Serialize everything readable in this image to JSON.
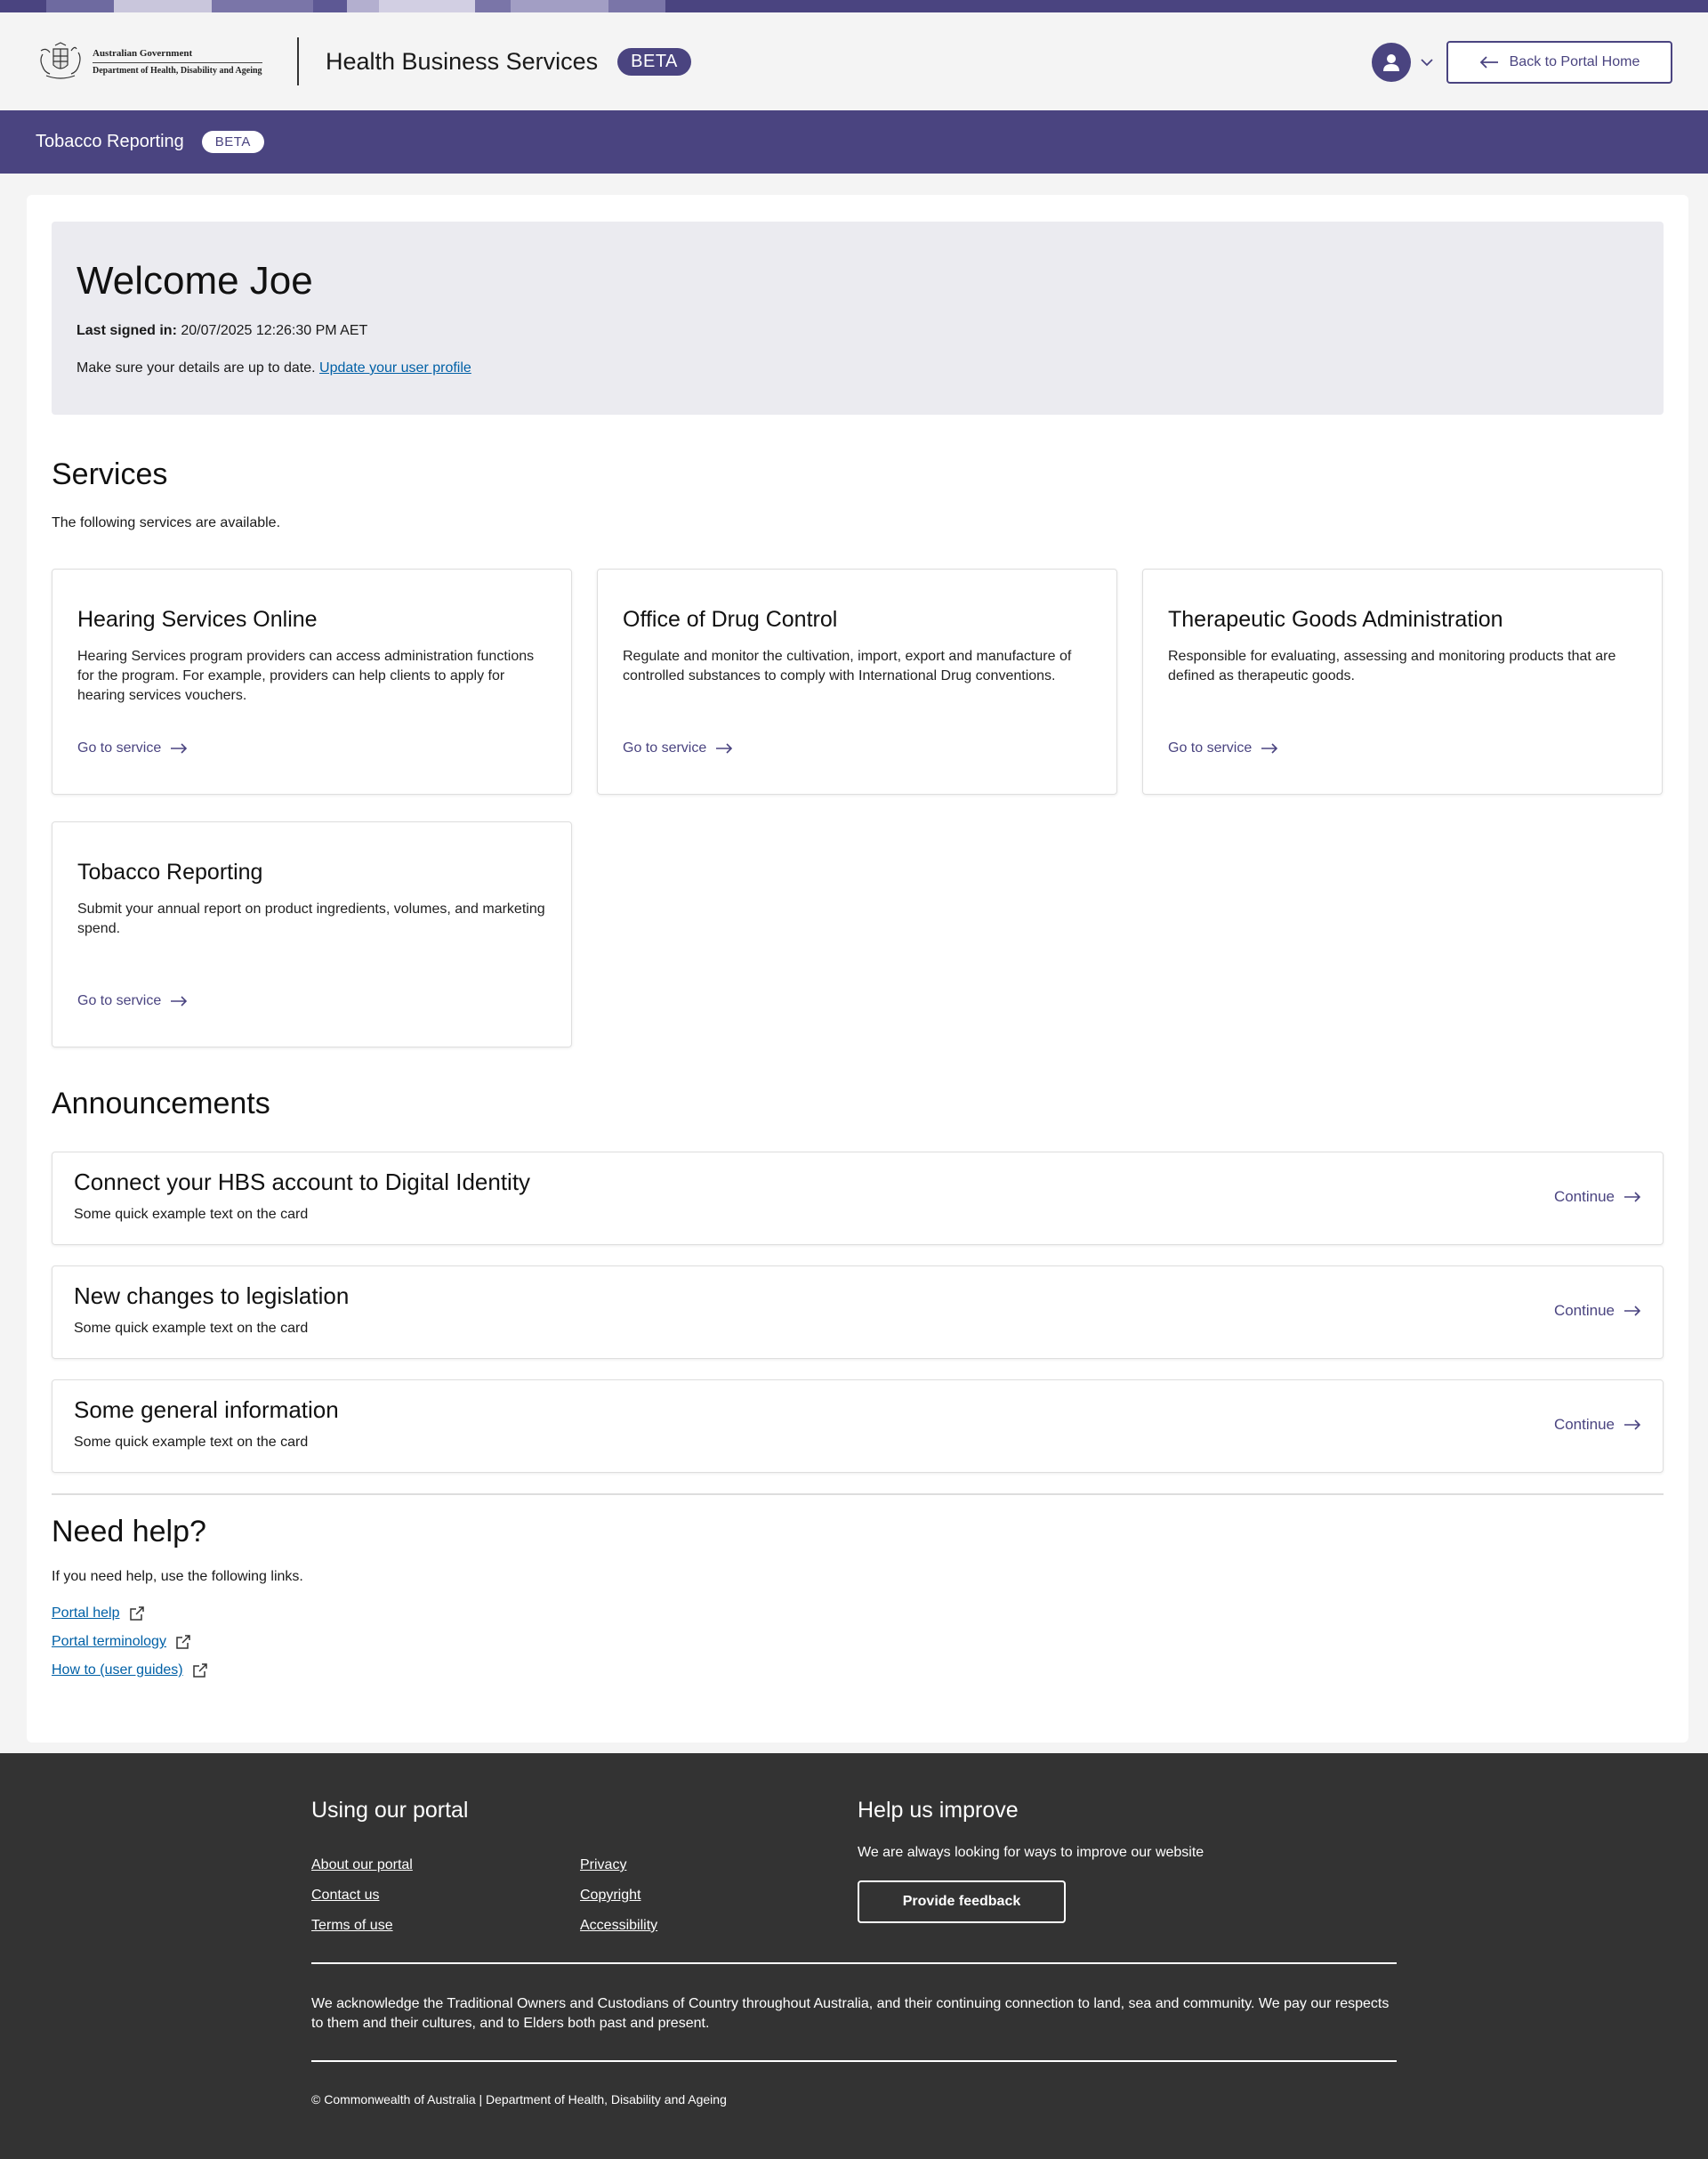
{
  "colors": {
    "brand": "#4a4480",
    "link": "#0060a6",
    "footer_bg": "#333333"
  },
  "header": {
    "gov_line1": "Australian Government",
    "gov_line2": "Department of Health, Disability and Ageing",
    "site_name": "Health Business Services",
    "beta": "BETA",
    "avatar_icon": "user-icon",
    "back_label": "Back to Portal Home"
  },
  "service_bar": {
    "name": "Tobacco Reporting",
    "beta": "BETA"
  },
  "welcome": {
    "title": "Welcome Joe",
    "last_signed_label": "Last signed in:",
    "last_signed_value": "20/07/2025 12:26:30 PM AET",
    "details_text": "Make sure your details are up to date.",
    "details_link": "Update your user profile"
  },
  "services": {
    "heading": "Services",
    "description": "The following services are available.",
    "go_label": "Go to service",
    "items": [
      {
        "title": "Hearing Services Online",
        "description": "Hearing Services program providers can access administration functions for the program. For example, providers can help clients to apply for hearing services vouchers."
      },
      {
        "title": "Office of Drug Control",
        "description": "Regulate and monitor the cultivation, import, export and manufacture of controlled substances to comply with International Drug conventions."
      },
      {
        "title": "Therapeutic Goods Administration",
        "description": "Responsible for evaluating, assessing and monitoring products that are defined as therapeutic goods."
      },
      {
        "title": "Tobacco Reporting",
        "description": "Submit your annual report on product ingredients, volumes, and marketing spend."
      }
    ]
  },
  "announcements": {
    "heading": "Announcements",
    "continue_label": "Continue",
    "items": [
      {
        "title": "Connect your HBS account to Digital Identity",
        "text": "Some quick example text on the card"
      },
      {
        "title": "New changes to legislation",
        "text": "Some quick example text on the card"
      },
      {
        "title": "Some general information",
        "text": "Some quick example text on the card"
      }
    ]
  },
  "help": {
    "heading": "Need help?",
    "description": "If you need help, use the following links.",
    "links": [
      "Portal help",
      "Portal terminology",
      "How to (user guides)"
    ]
  },
  "footer": {
    "using_heading": "Using our portal",
    "links": [
      "About our portal",
      "Privacy",
      "Contact us",
      "Copyright",
      "Terms of use",
      "Accessibility"
    ],
    "improve_heading": "Help us improve",
    "improve_text": "We are always looking for ways to improve our website",
    "feedback_label": "Provide feedback",
    "acknowledgement": "We acknowledge the Traditional Owners and Custodians of Country throughout Australia, and their continuing connection to land, sea and community. We pay our respects to them and their cultures, and to Elders both past and present.",
    "copyright": "© Commonwealth of Australia | Department of Health, Disability and Ageing"
  }
}
